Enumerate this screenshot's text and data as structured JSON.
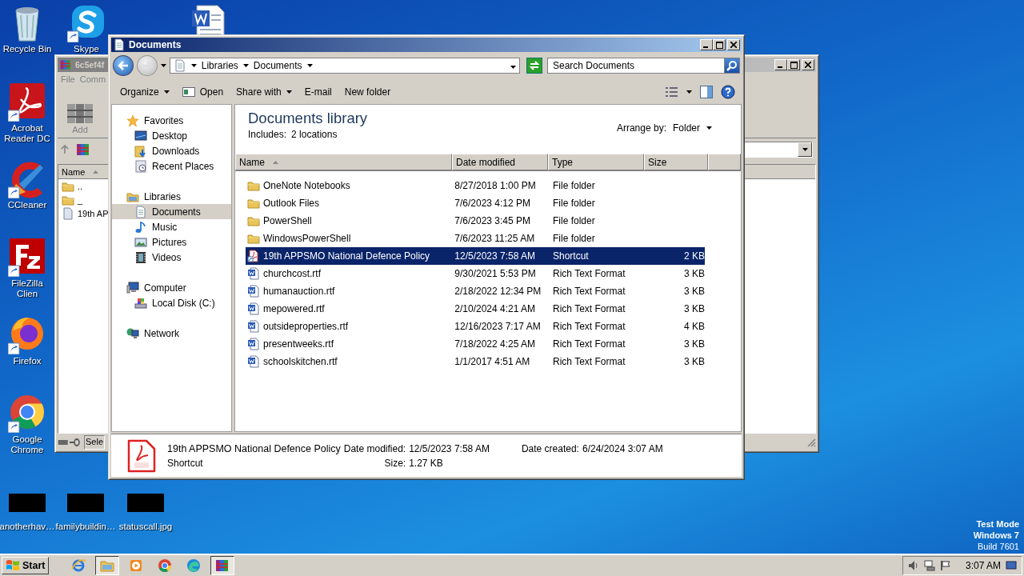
{
  "desktop_icons": [
    {
      "label": "Recycle Bin",
      "kind": "recycle",
      "shortcut": false
    },
    {
      "label": "Skype",
      "kind": "skype",
      "shortcut": true
    },
    {
      "kind": "word",
      "shortcut": false
    },
    {
      "label": "Acrobat Reader DC",
      "kind": "acrobat",
      "shortcut": true
    },
    {
      "label": "CCleaner",
      "kind": "ccleaner",
      "shortcut": true
    },
    {
      "label": "FileZilla Clien",
      "kind": "filezilla",
      "shortcut": true
    },
    {
      "label": "Firefox",
      "kind": "firefox",
      "shortcut": true
    },
    {
      "label": "Google Chrome",
      "kind": "chrome",
      "shortcut": true
    },
    {
      "label": "anotherhav…",
      "kind": "thumbnail"
    },
    {
      "label": "familybuildin…",
      "kind": "thumbnail"
    },
    {
      "label": "statuscall.jpg",
      "kind": "thumbnail"
    }
  ],
  "background_window": {
    "title": "6c5ef4f",
    "menu": [
      "File",
      "Comm"
    ],
    "tool": "Add",
    "column": "Name",
    "status": "Sele",
    "rows": [
      {
        "name": "..",
        "kind": "folder"
      },
      {
        "name": "_",
        "kind": "folder"
      },
      {
        "name": "19th AP",
        "kind": "file"
      }
    ]
  },
  "window": {
    "title": "Documents",
    "breadcrumb": [
      "Libraries",
      "Documents"
    ],
    "search": {
      "placeholder": "Search Documents"
    },
    "toolbar": [
      {
        "label": "Organize",
        "kind": "menu"
      },
      {
        "label": "Open",
        "kind": "open"
      },
      {
        "label": "Share with",
        "kind": "menu"
      },
      {
        "label": "E-mail",
        "kind": "plain"
      },
      {
        "label": "New folder",
        "kind": "plain"
      }
    ],
    "nav_pane": [
      {
        "label": "Favorites",
        "kind": "star",
        "selected": false,
        "children": [
          {
            "label": "Desktop",
            "kind": "desktop",
            "selected": false
          },
          {
            "label": "Downloads",
            "kind": "downloads",
            "selected": false
          },
          {
            "label": "Recent Places",
            "kind": "recent",
            "selected": false
          }
        ]
      },
      {
        "label": "Libraries",
        "kind": "libraries",
        "selected": false,
        "children": [
          {
            "label": "Documents",
            "kind": "documents",
            "selected": true
          },
          {
            "label": "Music",
            "kind": "music",
            "selected": false
          },
          {
            "label": "Pictures",
            "kind": "pictures",
            "selected": false
          },
          {
            "label": "Videos",
            "kind": "videos",
            "selected": false
          }
        ]
      },
      {
        "label": "Computer",
        "kind": "computer",
        "selected": false,
        "children": [
          {
            "label": "Local Disk (C:)",
            "kind": "disk",
            "selected": false
          }
        ]
      },
      {
        "label": "Network",
        "kind": "network",
        "selected": false
      }
    ],
    "library": {
      "title": "Documents library",
      "includes_label": "Includes:",
      "includes_link": "2 locations",
      "arrange_label": "Arrange by:",
      "arrange_value": "Folder"
    },
    "columns": [
      "Name",
      "Date modified",
      "Type",
      "Size"
    ],
    "rows": [
      {
        "name": "OneNote Notebooks",
        "date": "8/27/2018 1:00 PM",
        "type": "File folder",
        "kind": "folder",
        "selected": false
      },
      {
        "name": "Outlook Files",
        "date": "7/6/2023 4:12 PM",
        "type": "File folder",
        "kind": "folder",
        "selected": false
      },
      {
        "name": "PowerShell",
        "date": "7/6/2023 3:45 PM",
        "type": "File folder",
        "kind": "folder",
        "selected": false
      },
      {
        "name": "WindowsPowerShell",
        "date": "7/6/2023 11:25 AM",
        "type": "File folder",
        "kind": "folder",
        "selected": false
      },
      {
        "name": "19th APPSMO National Defence Policy",
        "date": "12/5/2023 7:58 AM",
        "type": "Shortcut",
        "size": "2 KB",
        "kind": "pdf",
        "selected": true
      },
      {
        "name": "churchcost.rtf",
        "date": "9/30/2021 5:53 PM",
        "type": "Rich Text Format",
        "size": "3 KB",
        "kind": "rtf",
        "selected": false
      },
      {
        "name": "humanauction.rtf",
        "date": "2/18/2022 12:34 PM",
        "type": "Rich Text Format",
        "size": "3 KB",
        "kind": "rtf",
        "selected": false
      },
      {
        "name": "mepowered.rtf",
        "date": "2/10/2024 4:21 AM",
        "type": "Rich Text Format",
        "size": "3 KB",
        "kind": "rtf",
        "selected": false
      },
      {
        "name": "outsideproperties.rtf",
        "date": "12/16/2023 7:17 AM",
        "type": "Rich Text Format",
        "size": "4 KB",
        "kind": "rtf",
        "selected": false
      },
      {
        "name": "presentweeks.rtf",
        "date": "7/18/2022 4:25 AM",
        "type": "Rich Text Format",
        "size": "3 KB",
        "kind": "rtf",
        "selected": false
      },
      {
        "name": "schoolskitchen.rtf",
        "date": "1/1/2017 4:51 AM",
        "type": "Rich Text Format",
        "size": "3 KB",
        "kind": "rtf",
        "selected": false
      }
    ],
    "details": {
      "name": "19th APPSMO National Defence Policy",
      "type": "Shortcut",
      "properties": [
        {
          "label": "Date modified:",
          "value": "12/5/2023 7:58 AM"
        },
        {
          "label": "Size:",
          "value": "1.27 KB"
        },
        {
          "label": "Date created:",
          "value": "6/24/2024 3:07 AM"
        }
      ]
    }
  },
  "os_notice": [
    "Test Mode",
    "Windows 7",
    "Build 7601"
  ],
  "taskbar": {
    "start": "Start",
    "apps": [
      {
        "kind": "ie",
        "active": false
      },
      {
        "kind": "explorer",
        "active": true
      },
      {
        "kind": "media",
        "active": false
      },
      {
        "kind": "chrome",
        "active": false
      },
      {
        "kind": "edge",
        "active": false
      },
      {
        "kind": "winrar",
        "active": true
      }
    ],
    "time": "3:07 AM"
  }
}
